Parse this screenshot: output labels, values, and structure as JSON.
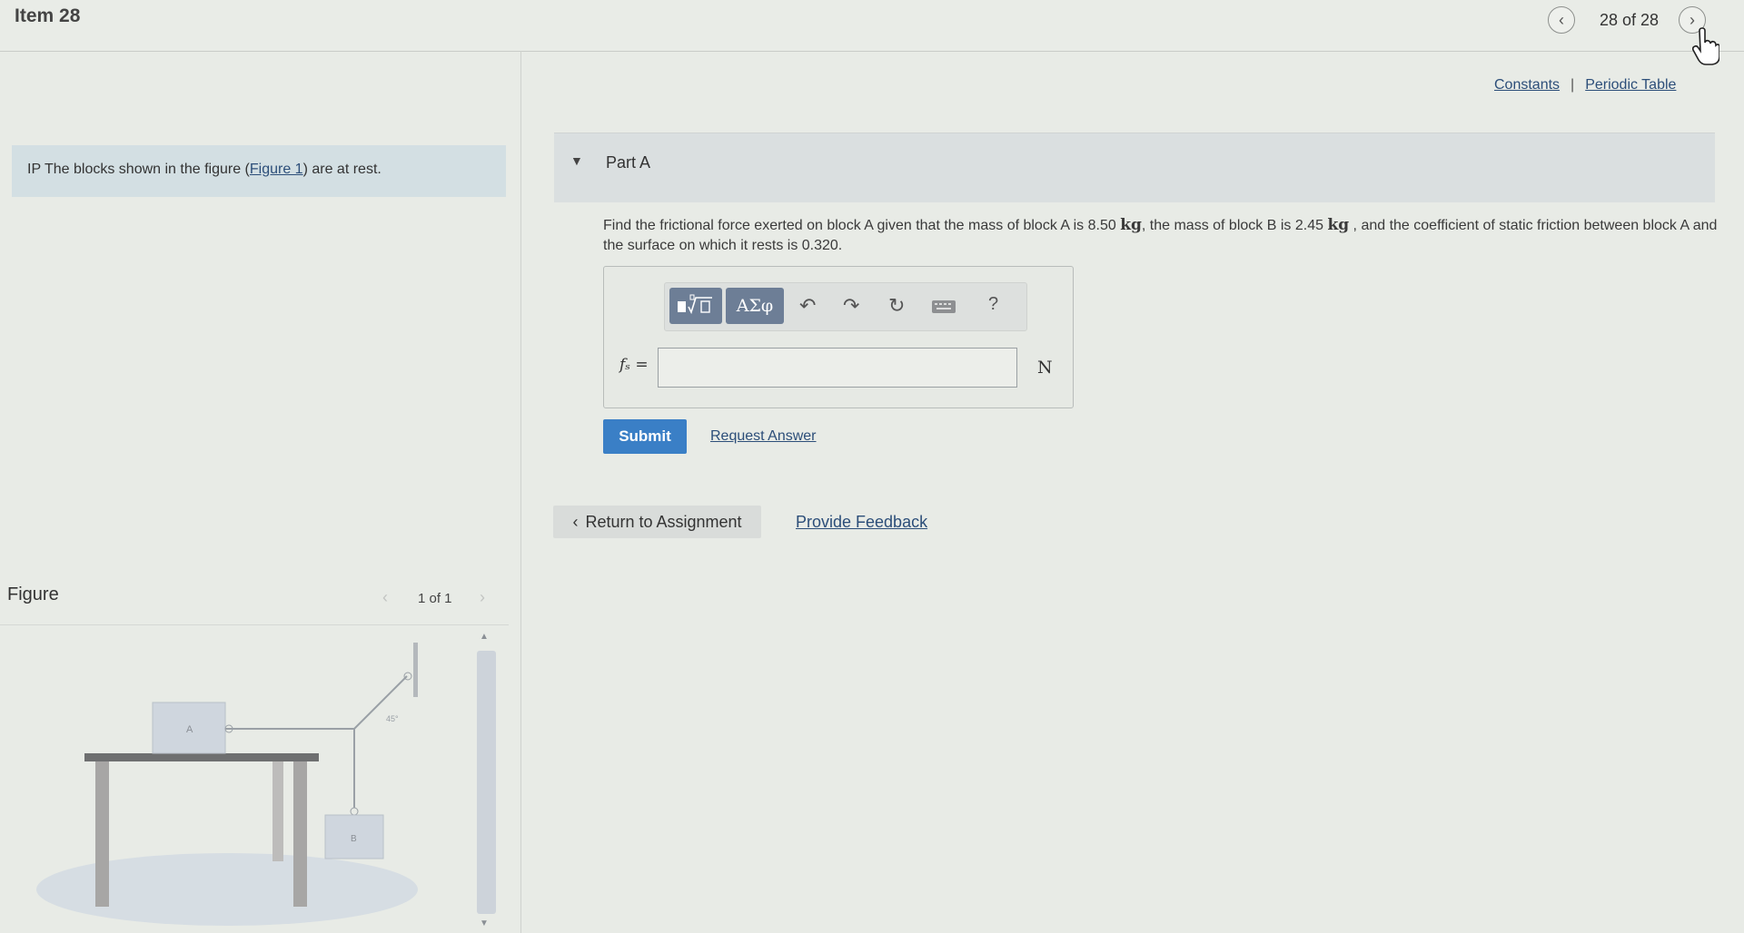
{
  "header": {
    "item_title": "Item 28",
    "position": "28 of 28",
    "prev_icon": "chevron-left-icon",
    "next_icon": "chevron-right-icon"
  },
  "links": {
    "constants": "Constants",
    "separator": "|",
    "periodic_table": "Periodic Table"
  },
  "intro": {
    "prefix": "IP The blocks shown in the figure (",
    "figure_link": "Figure 1",
    "suffix": ") are at rest."
  },
  "figure": {
    "label": "Figure",
    "counter": "1 of 1",
    "block_a_label": "A",
    "block_b_label": "B",
    "angle_label": "45°"
  },
  "part": {
    "title": "Part A",
    "question_1": "Find the frictional force exerted on block A given that the mass of block A is 8.50 ",
    "unit_kg": "kg",
    "question_2": ", the mass of block B is 2.45 ",
    "question_3": " , and the coefficient of static friction between block A and the surface on which it rests is 0.320."
  },
  "answer": {
    "variable": "fₛ =",
    "value": "",
    "unit": "N",
    "toolbar": {
      "templates_icon": "templates-icon",
      "symbols_label": "ΑΣφ",
      "help_label": "?"
    }
  },
  "actions": {
    "submit": "Submit",
    "request_answer": "Request Answer",
    "return": "Return to Assignment",
    "feedback": "Provide Feedback"
  },
  "colors": {
    "accent": "#3a7fc6",
    "link": "#2c4e79",
    "intro_bg": "#d3dfe3",
    "toolbar_btn": "#6d7e96"
  }
}
